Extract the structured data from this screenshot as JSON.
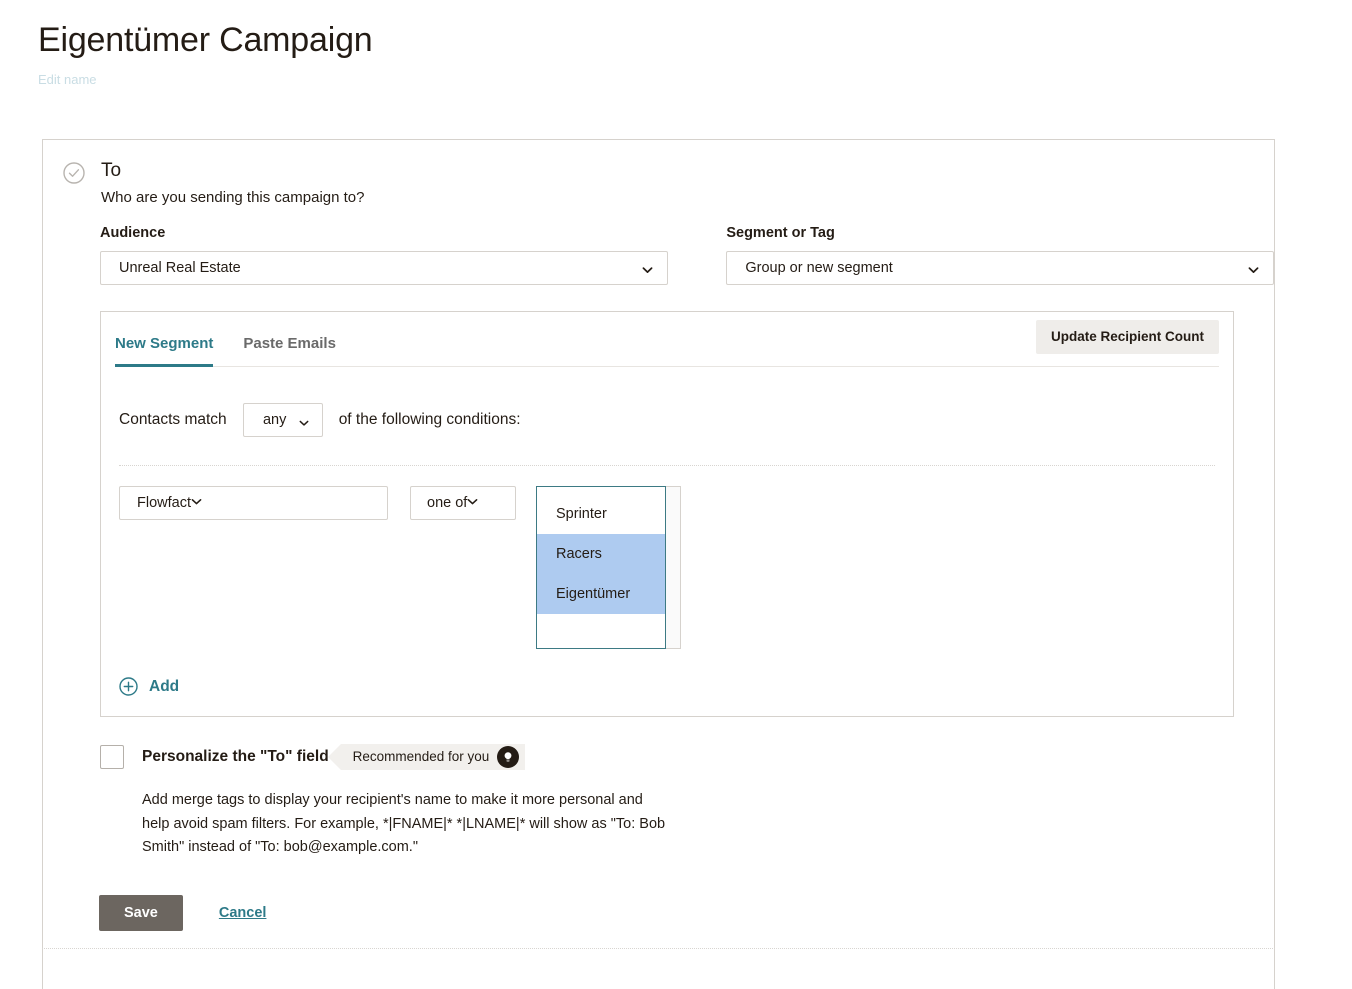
{
  "page": {
    "title": "Eigentümer Campaign",
    "edit_name_label": "Edit name"
  },
  "colors": {
    "accent_teal": "#2d7a88",
    "selection_blue": "#aecbf0",
    "save_button": "#6c6660",
    "badge_bg": "#f2f0ed",
    "card_border": "#d6d2cd",
    "edit_name": "#c9dde4"
  },
  "to_section": {
    "icon": "check-circle-icon",
    "title": "To",
    "subtitle": "Who are you sending this campaign to?",
    "audience": {
      "label": "Audience",
      "value": "Unreal Real Estate",
      "chevron_icon": "chevron-down-icon"
    },
    "segment_or_tag": {
      "label": "Segment or Tag",
      "value": "Group or new segment",
      "chevron_icon": "chevron-down-icon"
    }
  },
  "segment_panel": {
    "tabs": [
      {
        "label": "New Segment",
        "active": true
      },
      {
        "label": "Paste Emails",
        "active": false
      }
    ],
    "update_recipient_count_label": "Update Recipient Count",
    "match_prefix": "Contacts match",
    "match_operator": "any",
    "match_suffix": "of the following conditions:",
    "condition": {
      "field": "Flowfact",
      "operator": "one of",
      "options": [
        {
          "label": "Sprinter",
          "selected": false
        },
        {
          "label": "Racers",
          "selected": true
        },
        {
          "label": "Eigentümer",
          "selected": true
        }
      ]
    },
    "add": {
      "icon": "plus-circle-icon",
      "label": "Add"
    }
  },
  "personalize": {
    "checkbox_checked": false,
    "label": "Personalize the \"To\" field",
    "badge_text": "Recommended for you",
    "badge_icon": "lightbulb-icon",
    "description": "Add merge tags to display your recipient's name to make it more personal and help avoid spam filters. For example, *|FNAME|* *|LNAME|* will show as \"To: Bob Smith\" instead of \"To: bob@example.com.\""
  },
  "actions": {
    "save_label": "Save",
    "cancel_label": "Cancel"
  }
}
